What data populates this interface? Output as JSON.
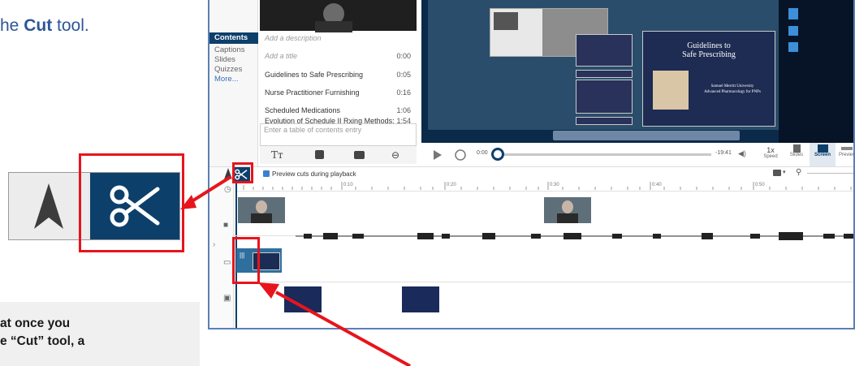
{
  "doc": {
    "title_prefix": "he ",
    "title_bold": "Cut",
    "title_suffix": " tool.",
    "note_line1": "at once you",
    "note_line2": "e “Cut” tool, a"
  },
  "sidebar": {
    "items": [
      "Contents",
      "Captions",
      "Slides",
      "Quizzes",
      "More..."
    ]
  },
  "toc": {
    "description_placeholder": "Add a description",
    "title_placeholder": "Add a title",
    "title_time": "0:00",
    "entries": [
      {
        "label": "Guidelines to Safe Prescribing",
        "time": "0:05"
      },
      {
        "label": "Nurse Practitioner Furnishing",
        "time": "0:16"
      },
      {
        "label": "Scheduled Medications",
        "time": "1:06"
      },
      {
        "label": "Evolution of Schedule II Rxing Methods:",
        "time": "1:54"
      }
    ],
    "entry_placeholder": "Enter a table of contents entry"
  },
  "slide": {
    "title_line1": "Guidelines to",
    "title_line2": "Safe Prescribing",
    "caption_line1": "Samuel Merritt University",
    "caption_line2": "Advanced Pharmacology for PNPs"
  },
  "player": {
    "time_current": "0:00",
    "time_remaining": "-19:41",
    "speed_value": "1x",
    "speed_label": "Speed",
    "slides_label": "Slides",
    "screen_label": "Screen",
    "preview_label": "Preview"
  },
  "timeline": {
    "preview_cuts_label": "Preview cuts during playback",
    "ticks": [
      "0:10",
      "0:20",
      "0:30",
      "0:40",
      "0:50"
    ]
  },
  "colors": {
    "accent_blue": "#0d3f6b",
    "highlight_red": "#e8141c",
    "title_blue": "#2e5597"
  }
}
